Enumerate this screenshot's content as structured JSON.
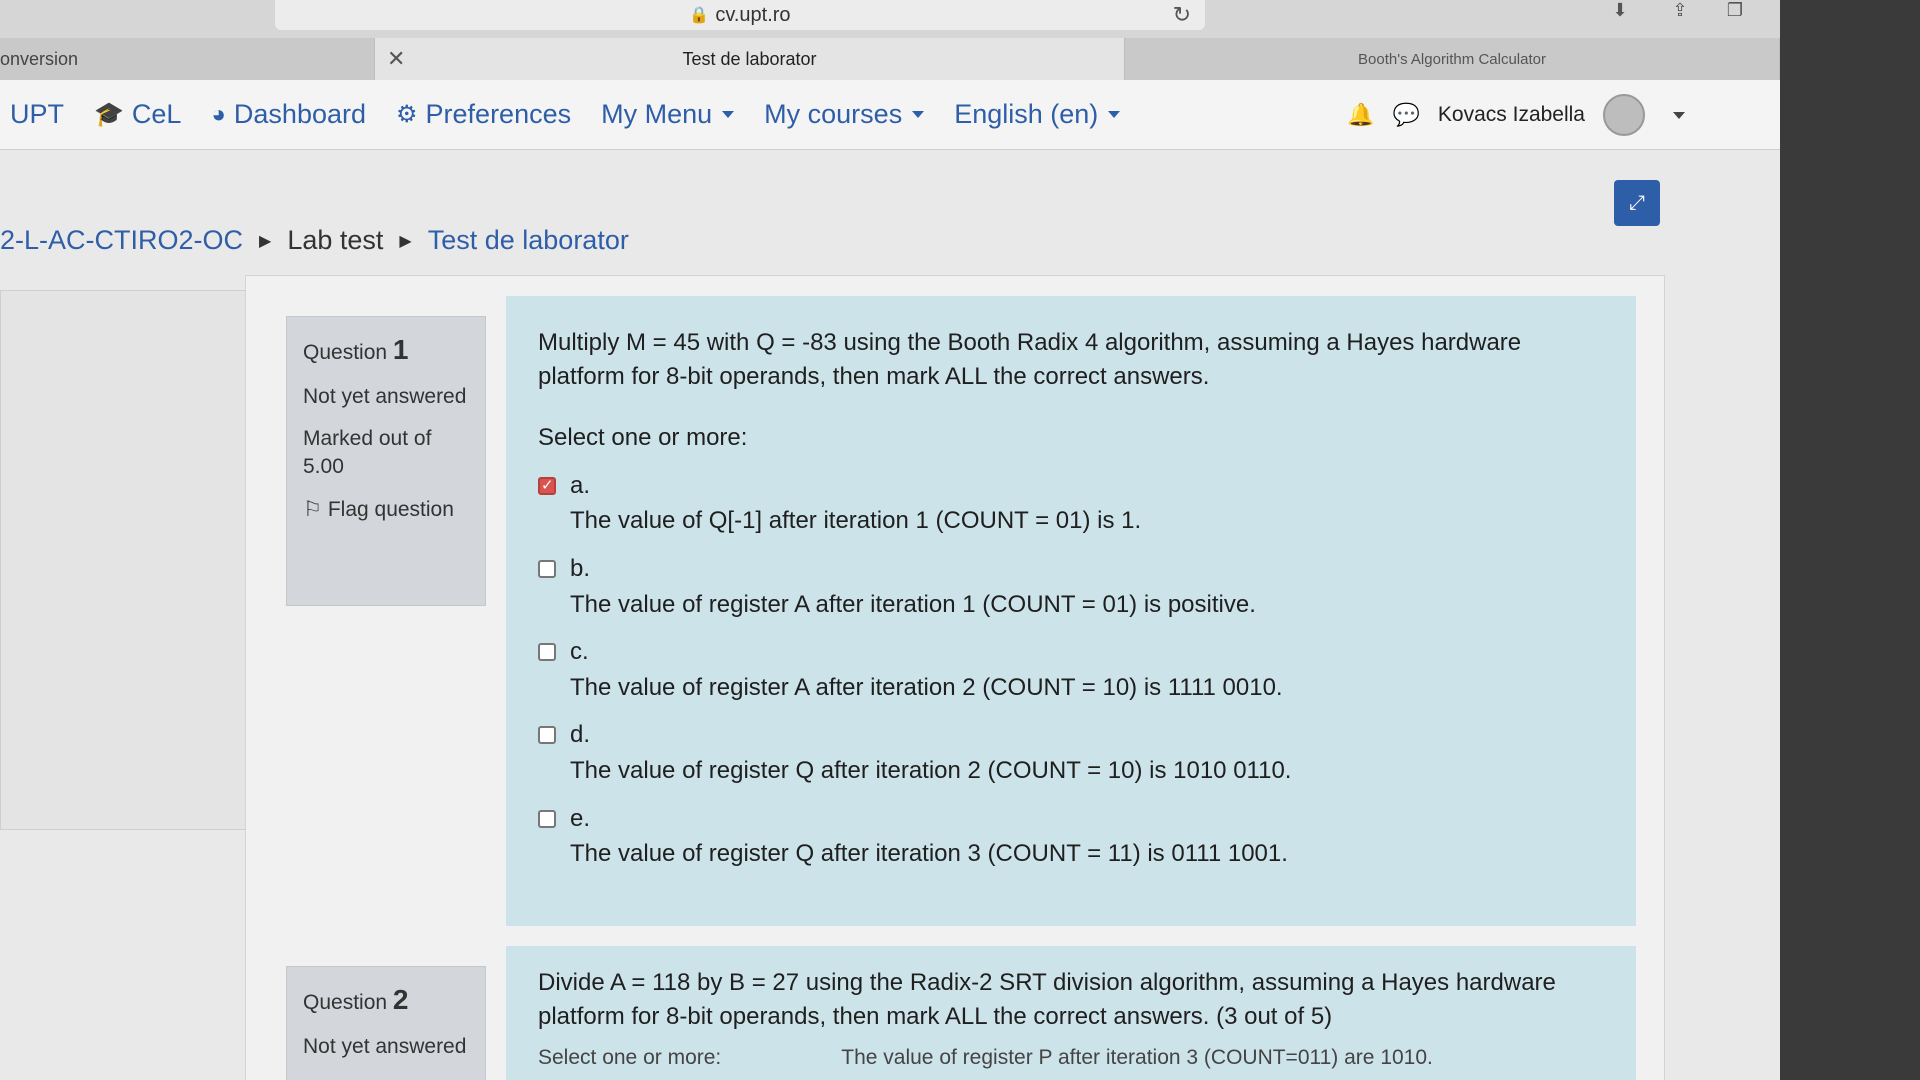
{
  "browser": {
    "address": "cv.upt.ro",
    "tabs": [
      {
        "label": "onversion"
      },
      {
        "label": "Test de laborator"
      },
      {
        "label": "Booth's Algorithm Calculator"
      }
    ]
  },
  "nav": {
    "items": [
      {
        "label": "UPT"
      },
      {
        "label": "CeL"
      },
      {
        "label": "Dashboard"
      },
      {
        "label": "Preferences"
      },
      {
        "label": "My Menu"
      },
      {
        "label": "My courses"
      },
      {
        "label": "English (en)"
      }
    ],
    "user": "Kovacs Izabella"
  },
  "breadcrumb": {
    "course": "2-L-AC-CTIRO2-OC",
    "section": "Lab test",
    "page": "Test de laborator"
  },
  "question1": {
    "number_label": "Question",
    "number": "1",
    "status": "Not yet answered",
    "marks": "Marked out of 5.00",
    "flag": "Flag question",
    "text": "Multiply M = 45 with Q = -83 using the Booth Radix 4 algorithm, assuming a Hayes hardware platform for 8-bit operands, then mark ALL the correct answers.",
    "prompt": "Select one or more:",
    "options": [
      {
        "label": "a.",
        "text": "The value of Q[-1] after iteration 1 (COUNT = 01) is 1.",
        "checked": true
      },
      {
        "label": "b.",
        "text": "The value of register A after iteration 1 (COUNT = 01) is positive.",
        "checked": false
      },
      {
        "label": "c.",
        "text": "The value of register A after iteration 2 (COUNT = 10) is 1111 0010.",
        "checked": false
      },
      {
        "label": "d.",
        "text": "The value of register Q after iteration 2 (COUNT = 10) is 1010 0110.",
        "checked": false
      },
      {
        "label": "e.",
        "text": "The value of register Q after iteration 3 (COUNT = 11) is 0111 1001.",
        "checked": false
      }
    ]
  },
  "question2": {
    "number_label": "Question",
    "number": "2",
    "status": "Not yet answered",
    "text": "Divide A = 118 by B = 27 using the Radix-2 SRT division algorithm, assuming a Hayes hardware platform for 8-bit operands, then mark ALL the correct answers. (3 out of 5)",
    "prompt": "Select one or more:",
    "partial_option": "The value of register P after iteration 3 (COUNT=011) are 1010."
  }
}
